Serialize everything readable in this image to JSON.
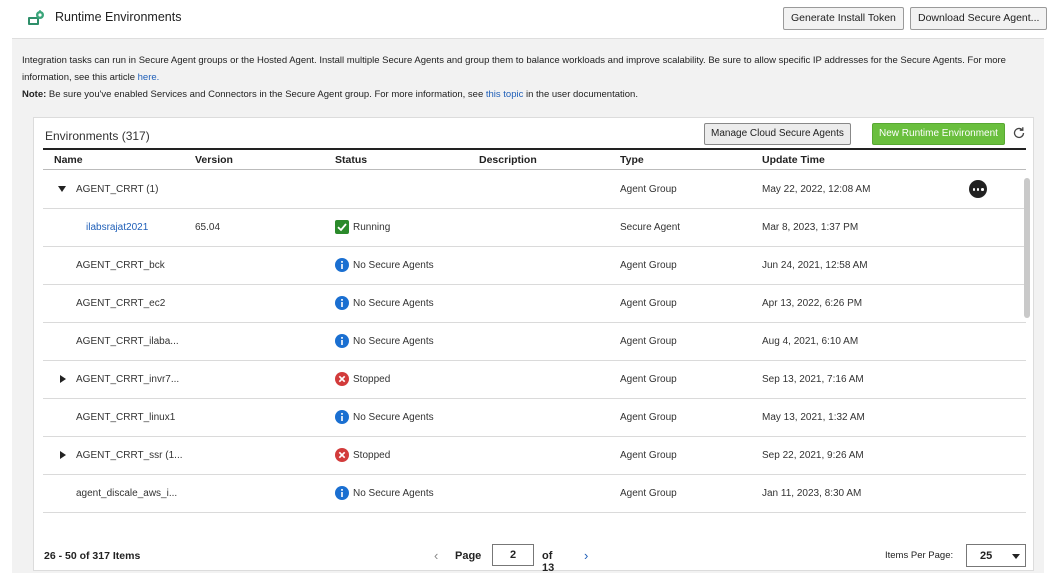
{
  "header": {
    "title": "Runtime Environments",
    "icon": "runtime-env-icon",
    "buttons": {
      "generate_token": "Generate Install Token",
      "download_agent": "Download Secure Agent..."
    }
  },
  "info": {
    "line1_pre": "Integration tasks can run in Secure Agent groups or the Hosted Agent. Install multiple Secure Agents and group them to balance workloads and improve scalability. Be sure to allow specific IP addresses for the Secure Agents. For more information, see this article ",
    "line1_link": "here.",
    "note_label": "Note:",
    "line2_pre": " Be sure you've enabled Services and Connectors in the Secure Agent group. For more information, see ",
    "line2_link": "this topic",
    "line2_post": " in the user documentation."
  },
  "panel": {
    "title": "Environments (317)",
    "manage_button": "Manage Cloud Secure Agents",
    "new_button": "New Runtime Environment",
    "columns": {
      "name": "Name",
      "version": "Version",
      "status": "Status",
      "description": "Description",
      "type": "Type",
      "update_time": "Update Time"
    },
    "rows": [
      {
        "name": "AGENT_CRRT (1)",
        "version": "",
        "status": "",
        "status_kind": "",
        "type": "Agent Group",
        "update_time": "May 22, 2022, 12:08 AM"
      },
      {
        "name": "ilabsrajat2021",
        "version": "65.04",
        "status": "Running",
        "status_kind": "running",
        "type": "Secure Agent",
        "update_time": "Mar 8, 2023, 1:37 PM"
      },
      {
        "name": "AGENT_CRRT_bck",
        "version": "",
        "status": "No Secure Agents",
        "status_kind": "info",
        "type": "Agent Group",
        "update_time": "Jun 24, 2021, 12:58 AM"
      },
      {
        "name": "AGENT_CRRT_ec2",
        "version": "",
        "status": "No Secure Agents",
        "status_kind": "info",
        "type": "Agent Group",
        "update_time": "Apr 13, 2022, 6:26 PM"
      },
      {
        "name": "AGENT_CRRT_ilaba...",
        "version": "",
        "status": "No Secure Agents",
        "status_kind": "info",
        "type": "Agent Group",
        "update_time": "Aug 4, 2021, 6:10 AM"
      },
      {
        "name": "AGENT_CRRT_invr7...",
        "version": "",
        "status": "Stopped",
        "status_kind": "stopped",
        "type": "Agent Group",
        "update_time": "Sep 13, 2021, 7:16 AM"
      },
      {
        "name": "AGENT_CRRT_linux1",
        "version": "",
        "status": "No Secure Agents",
        "status_kind": "info",
        "type": "Agent Group",
        "update_time": "May 13, 2021, 1:32 AM"
      },
      {
        "name": "AGENT_CRRT_ssr (1...",
        "version": "",
        "status": "Stopped",
        "status_kind": "stopped",
        "type": "Agent Group",
        "update_time": "Sep 22, 2021, 9:26 AM"
      },
      {
        "name": "agent_discale_aws_i...",
        "version": "",
        "status": "No Secure Agents",
        "status_kind": "info",
        "type": "Agent Group",
        "update_time": "Jan 11, 2023, 8:30 AM"
      }
    ],
    "footer": {
      "count": "26 - 50 of 317 Items",
      "page_label": "Page",
      "page_value": "2",
      "of_label": "of 13",
      "items_per_page_label": "Items Per Page:",
      "items_per_page_value": "25"
    }
  },
  "colors": {
    "link": "#1f5fb8",
    "new_button": "#6abf3e",
    "running": "#2b8a2b",
    "info": "#1a6fd1",
    "stopped": "#d23b3b"
  }
}
